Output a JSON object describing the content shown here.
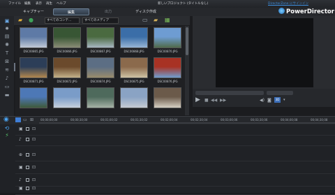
{
  "menu": [
    "ファイル",
    "編集",
    "表示",
    "再生",
    "ヘルプ"
  ],
  "title": "新しいプロジェクト (タイトルなし)",
  "signin": "DirectorZone にサインイン",
  "brand": "PowerDirector",
  "modes": [
    "キャプチャー",
    "編集",
    "出力",
    "ディスク作成"
  ],
  "active_mode": "編集",
  "filters": {
    "content": "すべてのコンテ...",
    "media": "すべてのメディア"
  },
  "thumbnails": [
    {
      "label": "DSC00865.JPG",
      "c1": "#5e7aa6",
      "c2": "#c1c9d6"
    },
    {
      "label": "DSC00866.JPG",
      "c1": "#385634",
      "c2": "#8a8c76"
    },
    {
      "label": "DSC00867.JPG",
      "c1": "#4a6a40",
      "c2": "#a7b6c2"
    },
    {
      "label": "DSC00868.JPG",
      "c1": "#3b6ea8",
      "c2": "#98b6d6"
    },
    {
      "label": "DSC00870.JPG",
      "c1": "#6e9cd2",
      "c2": "#4f6a4a"
    },
    {
      "label": "DSC00871.JPG",
      "c1": "#2c3e58",
      "c2": "#b2874e"
    },
    {
      "label": "DSC00872.JPG",
      "c1": "#6b4a2c",
      "c2": "#c4b28a"
    },
    {
      "label": "DSC00874.JPG",
      "c1": "#5c6e84",
      "c2": "#9a8c6c"
    },
    {
      "label": "DSC00875.JPG",
      "c1": "#8b6a4c",
      "c2": "#cfc3a4"
    },
    {
      "label": "DSC00876.JPG",
      "c1": "#a83224",
      "c2": "#6f9ed0"
    },
    {
      "label": "",
      "c1": "#4d78b6",
      "c2": "#3f5a3a"
    },
    {
      "label": "",
      "c1": "#7a9cc8",
      "c2": "#c6d0dc"
    },
    {
      "label": "",
      "c1": "#4e6a5c",
      "c2": "#a6b2a6"
    },
    {
      "label": "",
      "c1": "#8aa3c4",
      "c2": "#c6cbd2"
    },
    {
      "label": "",
      "c1": "#6b5a4a",
      "c2": "#d6d0c4"
    }
  ],
  "timecodes": [
    "00;00;00;00",
    "00;00;30;00",
    "00;01;00;02",
    "00;01;30;02",
    "00;02;00;04",
    "00;02;30;04",
    "00;03;00;06",
    "00;03;30;06",
    "00;04;00;08",
    "00;04;30;08"
  ],
  "colors": {
    "accent": "#3d8fe0",
    "panel": "#2a2c30",
    "bg": "#1b1c1f"
  }
}
